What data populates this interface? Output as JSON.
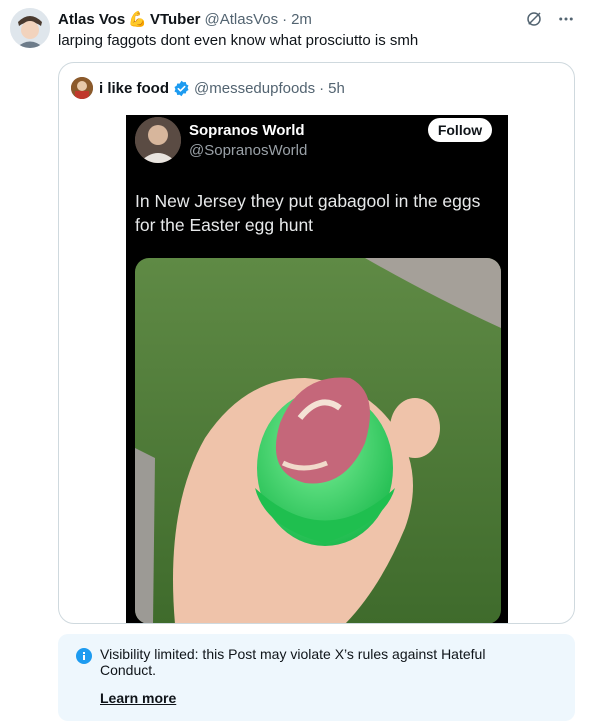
{
  "post": {
    "author_name": "Atlas Vos",
    "author_emoji": "💪",
    "author_suffix": "VTuber",
    "handle": "@AtlasVos",
    "separator": "·",
    "time": "2m",
    "text": "larping faggots dont even know what prosciutto is smh"
  },
  "quote": {
    "author_name": "i like food",
    "handle": "@messedupfoods",
    "separator": "·",
    "time": "5h",
    "media": {
      "author_name": "Sopranos World",
      "handle": "@SopranosWorld",
      "follow_label": "Follow",
      "text": "In New Jersey they put gabagool in the eggs for the Easter egg hunt"
    }
  },
  "notice": {
    "text": "Visibility limited: this Post may violate X’s rules against Hateful Conduct.",
    "link": "Learn more"
  },
  "icons": {
    "grok": "grok-icon",
    "more": "more-icon",
    "verified": "verified-badge-icon",
    "info": "info-icon"
  },
  "colors": {
    "accent": "#1d9bf0",
    "notice_bg": "#eef7fd",
    "muted": "#536471"
  }
}
